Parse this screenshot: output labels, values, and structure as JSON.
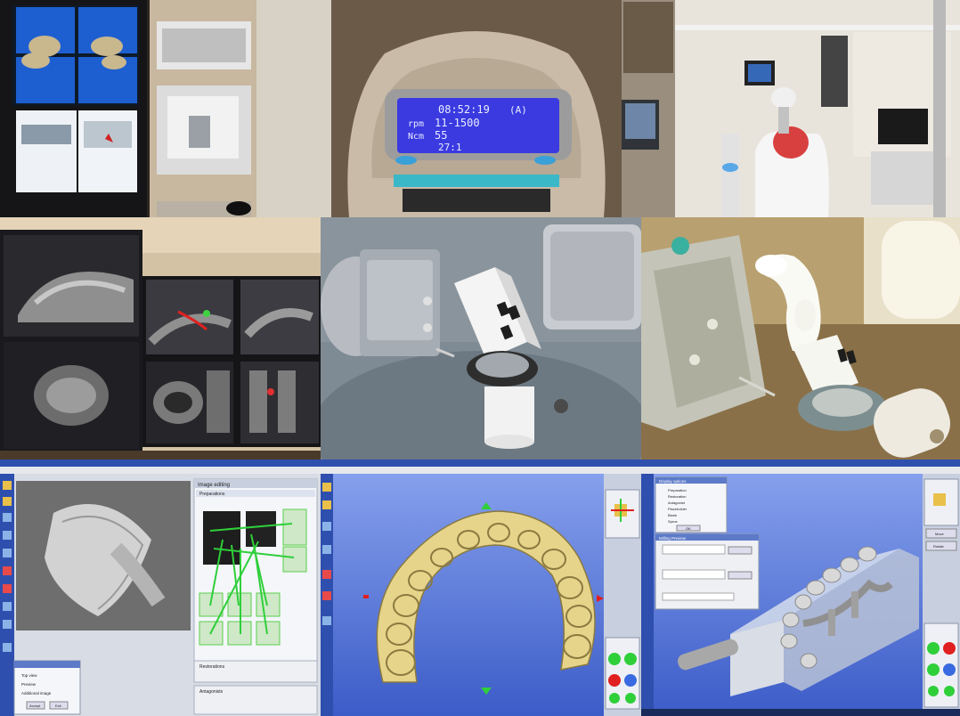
{
  "colors": {
    "lcd_bg": "#3a3ae0",
    "model_yellow": "#e6d48a",
    "viewport_blue": "#4a6bd8",
    "toolbar_blue": "#2f4fae",
    "panel_gray": "#d8dce4",
    "green_link": "#2fcf3a"
  },
  "motor_display": {
    "time": "08:52:19",
    "mode": "(A)",
    "rpm_label": "rpm",
    "rpm_value": "11-1500",
    "ncm_label": "Ncm",
    "ncm_value": "55",
    "ratio": "27:1"
  },
  "cam_panels": {
    "left": {
      "panel_title": "Image editing",
      "section_preparations": "Preparations",
      "section_restorations": "Restorations",
      "section_antagonists": "Antagonists",
      "dialog_options": [
        "Top view",
        "Preview",
        "Additional image"
      ],
      "dialog_buttons": [
        "Accept",
        "Exit"
      ]
    },
    "right": {
      "display_title": "Display options",
      "display_items": [
        "Preparation",
        "Restoration",
        "Antagonist",
        "Placeholder",
        "Blank",
        "Sprue"
      ],
      "ok_label": "OK",
      "milling_title": "Milling Preview",
      "move_label": "Move",
      "rotate_label": "Rotate"
    }
  }
}
